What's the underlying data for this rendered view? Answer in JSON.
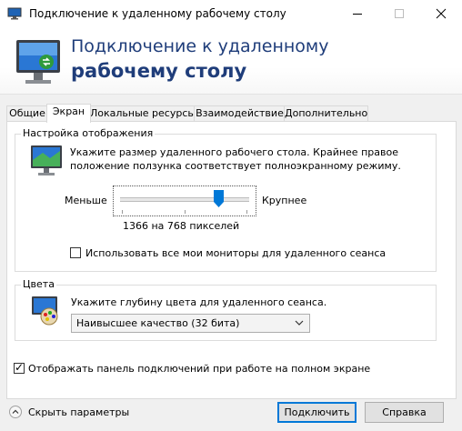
{
  "window": {
    "title": "Подключение к удаленному рабочему столу"
  },
  "header": {
    "line1": "Подключение к удаленному",
    "line2": "рабочему столу"
  },
  "tabs": [
    {
      "label": "Общие",
      "active": false
    },
    {
      "label": "Экран",
      "active": true
    },
    {
      "label": "Локальные ресурсы",
      "active": false
    },
    {
      "label": "Взаимодействие",
      "active": false
    },
    {
      "label": "Дополнительно",
      "active": false
    }
  ],
  "display_group": {
    "legend": "Настройка отображения",
    "description_line1": "Укажите размер удаленного рабочего стола. Крайнее правое",
    "description_line2": "положение ползунка соответствует полноэкранному режиму.",
    "slider": {
      "min_label": "Меньше",
      "max_label": "Крупнее",
      "value_text": "1366 на 768 пикселей",
      "position_fraction": 0.78
    },
    "all_monitors": {
      "label": "Использовать все мои мониторы для удаленного сеанса",
      "checked": false
    }
  },
  "colors_group": {
    "legend": "Цвета",
    "description": "Укажите глубину цвета для удаленного сеанса.",
    "depth_select": {
      "value": "Наивысшее качество (32 бита)"
    }
  },
  "connection_bar": {
    "label": "Отображать панель подключений при работе на полном экране",
    "checked": true
  },
  "footer": {
    "hide_options": "Скрыть параметры",
    "connect": "Подключить",
    "help": "Справка"
  },
  "colors": {
    "accent": "#0078d7",
    "header_text": "#1f3d7a"
  }
}
